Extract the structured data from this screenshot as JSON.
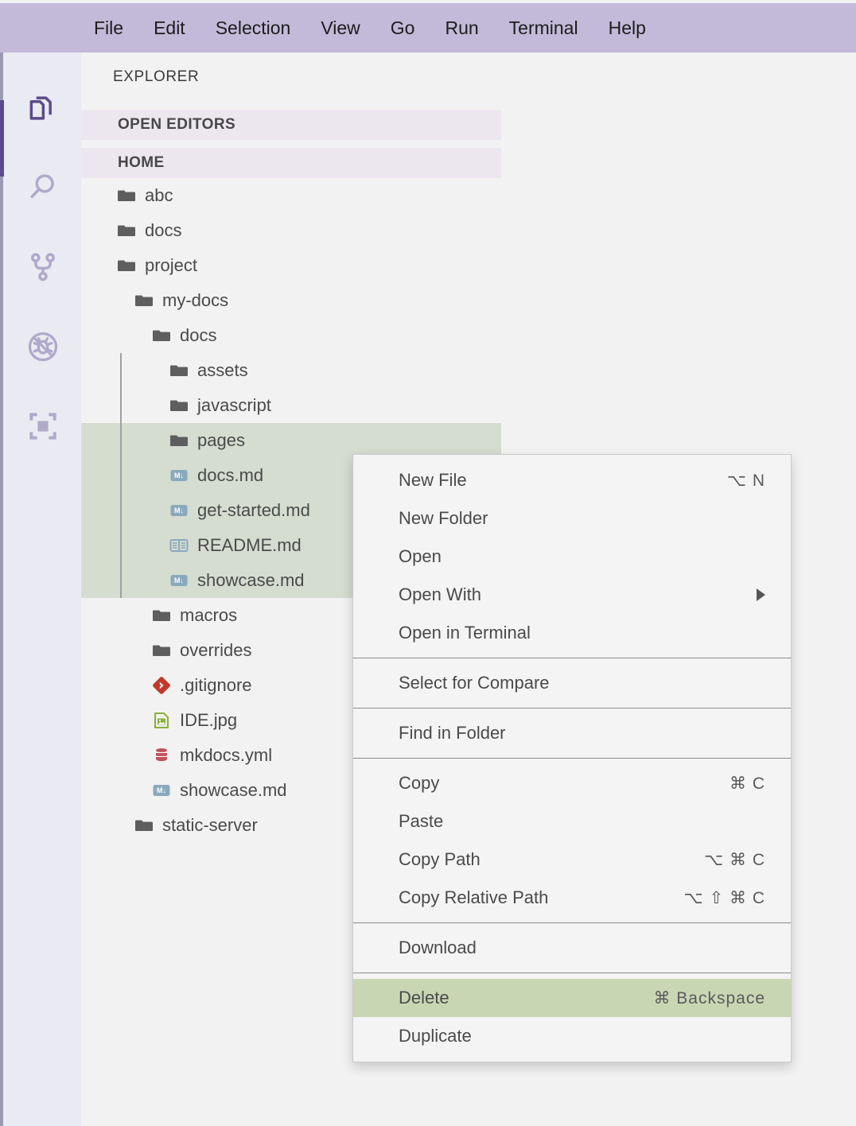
{
  "menubar": {
    "items": [
      {
        "label": "File"
      },
      {
        "label": "Edit"
      },
      {
        "label": "Selection"
      },
      {
        "label": "View"
      },
      {
        "label": "Go"
      },
      {
        "label": "Run"
      },
      {
        "label": "Terminal"
      },
      {
        "label": "Help"
      }
    ]
  },
  "activitybar": {
    "items": [
      {
        "icon": "files-explorer-icon",
        "active": true
      },
      {
        "icon": "search-icon",
        "active": false
      },
      {
        "icon": "source-control-branch-icon",
        "active": false
      },
      {
        "icon": "run-and-debug-icon",
        "active": false
      },
      {
        "icon": "extensions-icon",
        "active": false
      }
    ],
    "active_indicator_color": "#5b4b8a"
  },
  "explorer": {
    "title": "EXPLORER",
    "sections": [
      {
        "label": "OPEN EDITORS"
      },
      {
        "label": "HOME"
      }
    ],
    "tree": [
      {
        "label": "abc",
        "icon": "folder-icon",
        "depth": 0,
        "selected": false
      },
      {
        "label": "docs",
        "icon": "folder-icon",
        "depth": 0,
        "selected": false
      },
      {
        "label": "project",
        "icon": "folder-icon",
        "depth": 0,
        "selected": false
      },
      {
        "label": "my-docs",
        "icon": "folder-icon",
        "depth": 1,
        "selected": false
      },
      {
        "label": "docs",
        "icon": "folder-icon",
        "depth": 2,
        "selected": false
      },
      {
        "label": "assets",
        "icon": "folder-icon",
        "depth": 3,
        "selected": false
      },
      {
        "label": "javascript",
        "icon": "folder-icon",
        "depth": 3,
        "selected": false
      },
      {
        "label": "pages",
        "icon": "folder-icon",
        "depth": 3,
        "selected": true
      },
      {
        "label": "docs.md",
        "icon": "markdown-icon",
        "depth": 3,
        "selected": true
      },
      {
        "label": "get-started.md",
        "icon": "markdown-icon",
        "depth": 3,
        "selected": true
      },
      {
        "label": "README.md",
        "icon": "readme-book-icon",
        "depth": 3,
        "selected": true
      },
      {
        "label": "showcase.md",
        "icon": "markdown-icon",
        "depth": 3,
        "selected": true
      },
      {
        "label": "macros",
        "icon": "folder-icon",
        "depth": 2,
        "selected": false
      },
      {
        "label": "overrides",
        "icon": "folder-icon",
        "depth": 2,
        "selected": false
      },
      {
        "label": ".gitignore",
        "icon": "git-icon",
        "depth": 2,
        "selected": false
      },
      {
        "label": "IDE.jpg",
        "icon": "image-icon",
        "depth": 2,
        "selected": false
      },
      {
        "label": "mkdocs.yml",
        "icon": "yaml-database-icon",
        "depth": 2,
        "selected": false
      },
      {
        "label": "showcase.md",
        "icon": "markdown-icon",
        "depth": 2,
        "selected": false
      },
      {
        "label": "static-server",
        "icon": "folder-icon",
        "depth": 1,
        "selected": false
      }
    ]
  },
  "context_menu": {
    "highlighted_item": "Delete",
    "highlight_color": "#c9d6b3",
    "items": [
      {
        "type": "item",
        "label": "New File",
        "shortcut": "⌥ N",
        "submenu": false,
        "highlighted": false
      },
      {
        "type": "item",
        "label": "New Folder",
        "shortcut": "",
        "submenu": false,
        "highlighted": false
      },
      {
        "type": "item",
        "label": "Open",
        "shortcut": "",
        "submenu": false,
        "highlighted": false
      },
      {
        "type": "item",
        "label": "Open With",
        "shortcut": "",
        "submenu": true,
        "highlighted": false
      },
      {
        "type": "item",
        "label": "Open in Terminal",
        "shortcut": "",
        "submenu": false,
        "highlighted": false
      },
      {
        "type": "separator"
      },
      {
        "type": "item",
        "label": "Select for Compare",
        "shortcut": "",
        "submenu": false,
        "highlighted": false
      },
      {
        "type": "separator"
      },
      {
        "type": "item",
        "label": "Find in Folder",
        "shortcut": "",
        "submenu": false,
        "highlighted": false
      },
      {
        "type": "separator"
      },
      {
        "type": "item",
        "label": "Copy",
        "shortcut": "⌘ C",
        "submenu": false,
        "highlighted": false
      },
      {
        "type": "item",
        "label": "Paste",
        "shortcut": "",
        "submenu": false,
        "highlighted": false
      },
      {
        "type": "item",
        "label": "Copy Path",
        "shortcut": "⌥ ⌘ C",
        "submenu": false,
        "highlighted": false
      },
      {
        "type": "item",
        "label": "Copy Relative Path",
        "shortcut": "⌥ ⇧ ⌘ C",
        "submenu": false,
        "highlighted": false
      },
      {
        "type": "separator"
      },
      {
        "type": "item",
        "label": "Download",
        "shortcut": "",
        "submenu": false,
        "highlighted": false
      },
      {
        "type": "separator"
      },
      {
        "type": "item",
        "label": "Delete",
        "shortcut": "⌘ Backspace",
        "submenu": false,
        "highlighted": true
      },
      {
        "type": "item",
        "label": "Duplicate",
        "shortcut": "",
        "submenu": false,
        "highlighted": false
      }
    ]
  },
  "colors": {
    "menubar_bg": "#c3bad9",
    "activitybar_bg": "#eaebf2",
    "explorer_bg": "#f2f2f2",
    "section_header_bg": "#ece7ef",
    "tree_selection_bg": "#d5dcd0",
    "menu_bg": "#f4f4f4",
    "accent_purple": "#5b4b8a"
  }
}
